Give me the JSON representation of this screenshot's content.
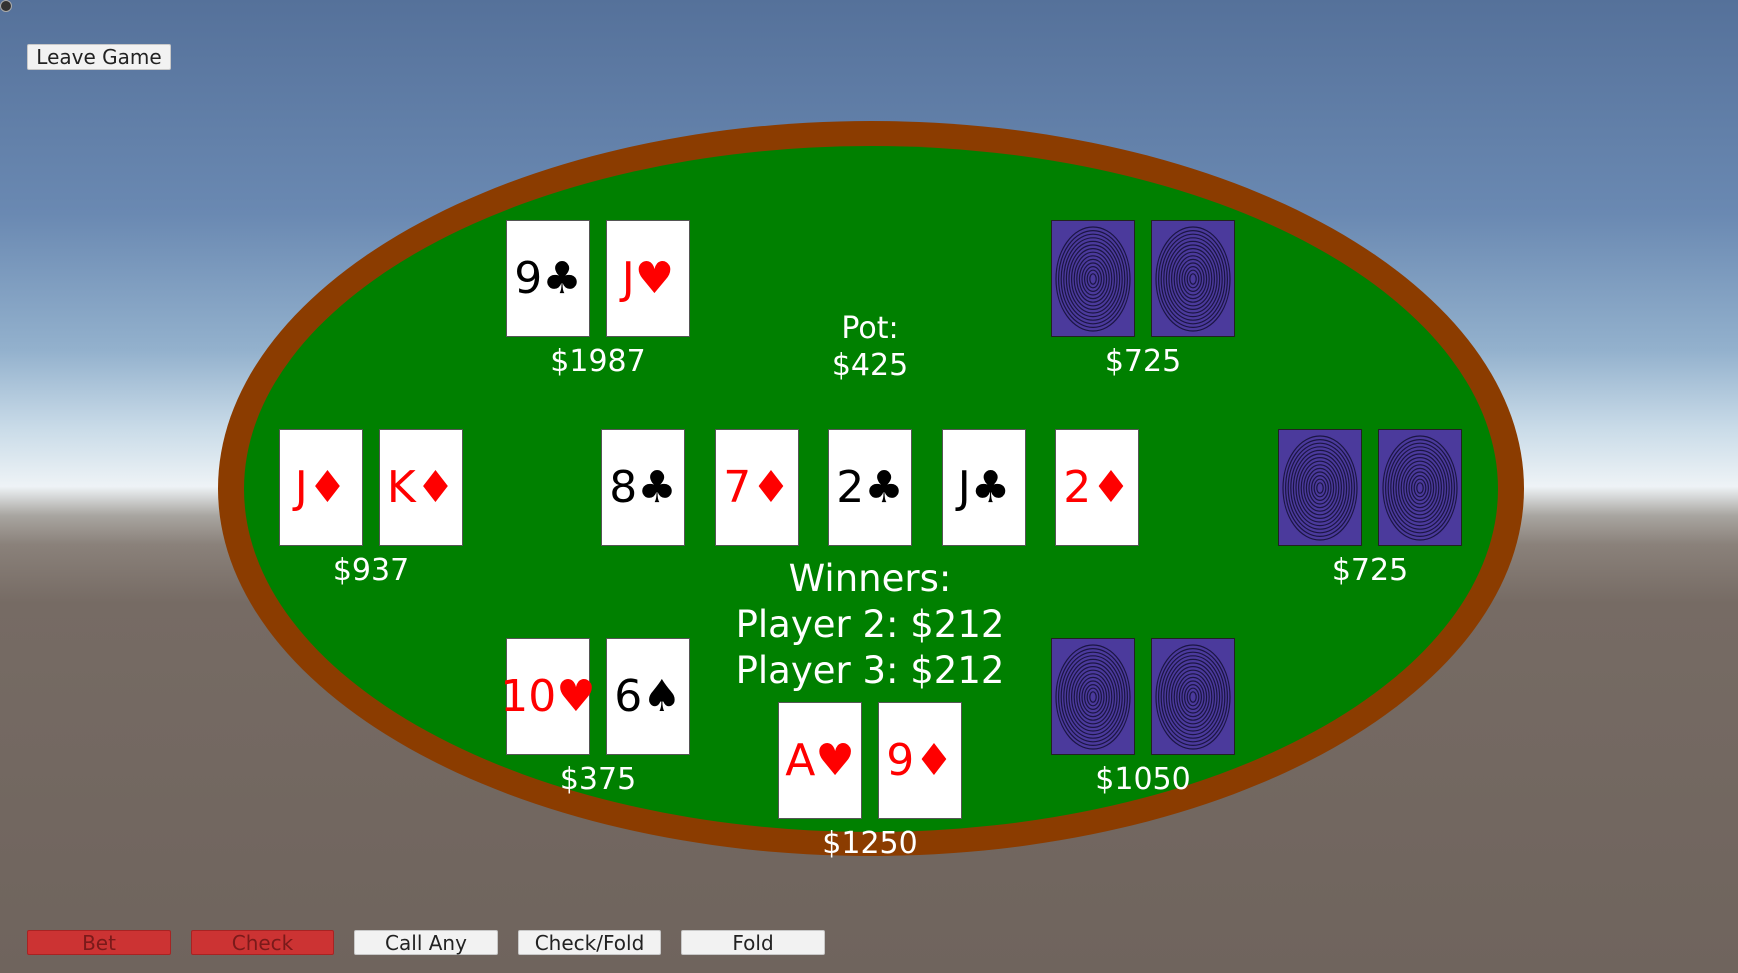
{
  "ui": {
    "leave_game": "Leave Game"
  },
  "actions": [
    {
      "label": "Bet",
      "style": "disabled-red"
    },
    {
      "label": "Check",
      "style": "disabled-red"
    },
    {
      "label": "Call Any",
      "style": "normal"
    },
    {
      "label": "Check/Fold",
      "style": "normal"
    },
    {
      "label": "Fold",
      "style": "normal"
    }
  ],
  "pot": {
    "label": "Pot:",
    "amount": "$425"
  },
  "community_cards": [
    {
      "text": "8♣",
      "color": "black"
    },
    {
      "text": "7♦",
      "color": "red"
    },
    {
      "text": "2♣",
      "color": "black"
    },
    {
      "text": "J♣",
      "color": "black"
    },
    {
      "text": "2♦",
      "color": "red"
    }
  ],
  "winners": {
    "title": "Winners:",
    "lines": [
      "Player 2: $212",
      "Player 3: $212"
    ]
  },
  "seats": [
    {
      "position": "top-left",
      "chips": "$1987",
      "cards": [
        {
          "text": "9♣",
          "color": "black"
        },
        {
          "text": "J♥",
          "color": "red"
        }
      ]
    },
    {
      "position": "top-right",
      "chips": "$725",
      "cards": "face-down"
    },
    {
      "position": "left",
      "chips": "$937",
      "cards": [
        {
          "text": "J♦",
          "color": "red"
        },
        {
          "text": "K♦",
          "color": "red"
        }
      ]
    },
    {
      "position": "right",
      "chips": "$725",
      "cards": "face-down"
    },
    {
      "position": "bottom-left",
      "chips": "$375",
      "cards": [
        {
          "text": "10♥",
          "color": "red"
        },
        {
          "text": "6♠",
          "color": "black"
        }
      ]
    },
    {
      "position": "bottom-center",
      "chips": "$1250",
      "cards": [
        {
          "text": "A♥",
          "color": "red"
        },
        {
          "text": "9♦",
          "color": "red"
        }
      ]
    },
    {
      "position": "bottom-right",
      "chips": "$1050",
      "cards": "face-down"
    }
  ],
  "colors": {
    "felt": "#008000",
    "rim": "#8b3c00",
    "card_back": "#4b3a9c",
    "red_suit": "#ff0000",
    "disabled_button": "#cc3333"
  },
  "icons": {
    "card_back_pattern": "concentric-ring-icon"
  }
}
